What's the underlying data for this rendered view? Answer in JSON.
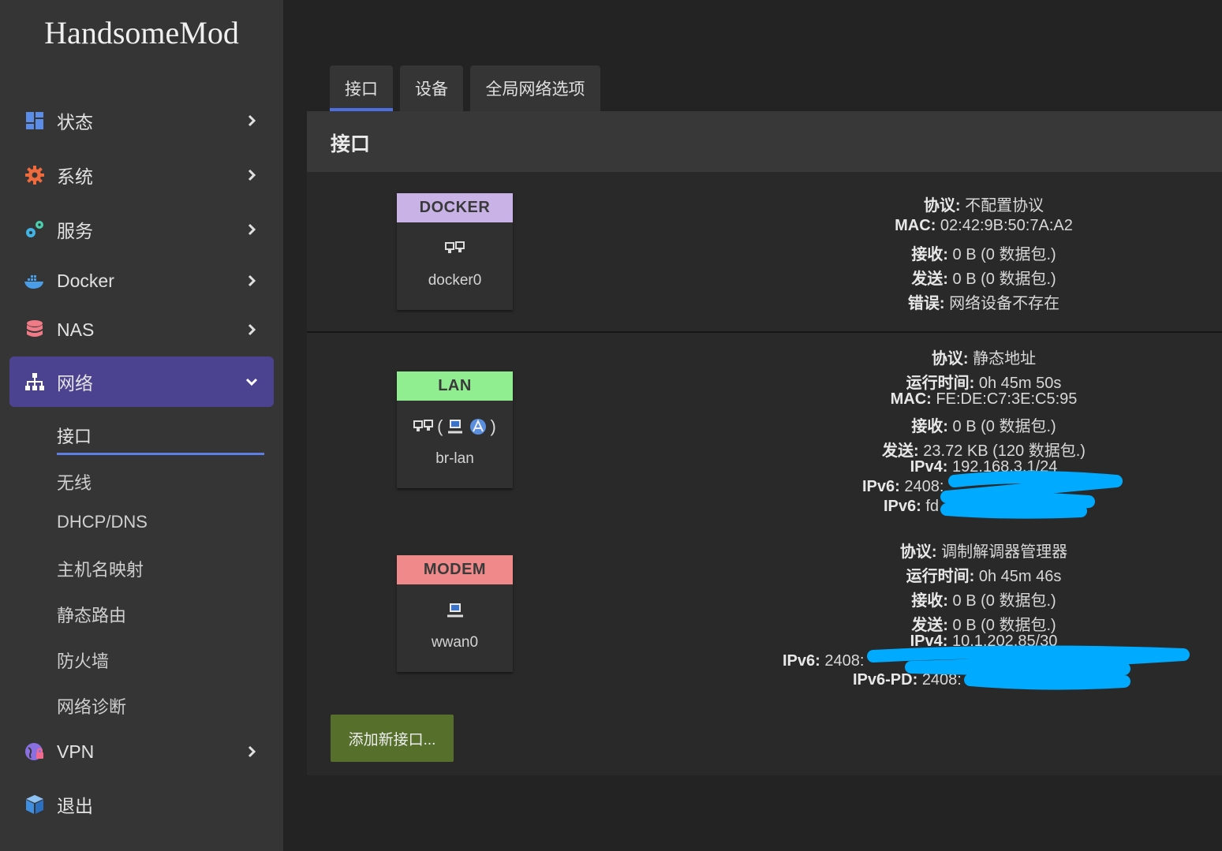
{
  "brand": "HandsomeMod",
  "sidebar": {
    "items": [
      {
        "label": "状态",
        "icon": "dashboard-icon"
      },
      {
        "label": "系统",
        "icon": "gear-icon"
      },
      {
        "label": "服务",
        "icon": "cogs-icon"
      },
      {
        "label": "Docker",
        "icon": "docker-icon"
      },
      {
        "label": "NAS",
        "icon": "database-icon"
      },
      {
        "label": "网络",
        "icon": "sitemap-icon"
      },
      {
        "label": "VPN",
        "icon": "globe-lock-icon"
      },
      {
        "label": "退出",
        "icon": "cube-icon"
      }
    ],
    "network_sub": [
      "接口",
      "无线",
      "DHCP/DNS",
      "主机名映射",
      "静态路由",
      "防火墙",
      "网络诊断"
    ]
  },
  "tabs": [
    "接口",
    "设备",
    "全局网络选项"
  ],
  "panel": {
    "title": "接口",
    "add_button": "添加新接口..."
  },
  "labels": {
    "protocol": "协议:",
    "uptime": "运行时间:",
    "mac": "MAC:",
    "rx": "接收:",
    "tx": "发送:",
    "error": "错误:",
    "ipv4": "IPv4:",
    "ipv6": "IPv6:",
    "ipv6pd": "IPv6-PD:"
  },
  "interfaces": [
    {
      "name": "DOCKER",
      "device": "docker0",
      "color": "#c9b3e6",
      "protocol": "不配置协议",
      "mac": "02:42:9B:50:7A:A2",
      "rx": "0 B (0 数据包.)",
      "tx": "0 B (0 数据包.)",
      "error": "网络设备不存在"
    },
    {
      "name": "LAN",
      "device": "br-lan",
      "color": "#90ee90",
      "protocol": "静态地址",
      "uptime": "0h 45m 50s",
      "mac": "FE:DE:C7:3E:C5:95",
      "rx": "0 B (0 数据包.)",
      "tx": "23.72 KB (120 数据包.)",
      "ipv4": "192.168.3.1/24",
      "ipv6_a": "2408:",
      "ipv6_b": "fd"
    },
    {
      "name": "MODEM",
      "device": "wwan0",
      "color": "#f08a8a",
      "protocol": "调制解调器管理器",
      "uptime": "0h 45m 46s",
      "rx": "0 B (0 数据包.)",
      "tx": "0 B (0 数据包.)",
      "ipv4": "10.1.202.85/30",
      "ipv6": "2408:",
      "ipv6pd": "2408:"
    }
  ],
  "colors": {
    "accent": "#4c6ee0",
    "active_nav": "#4b4390",
    "redaction": "#00aaff",
    "add_button": "#56702c"
  }
}
